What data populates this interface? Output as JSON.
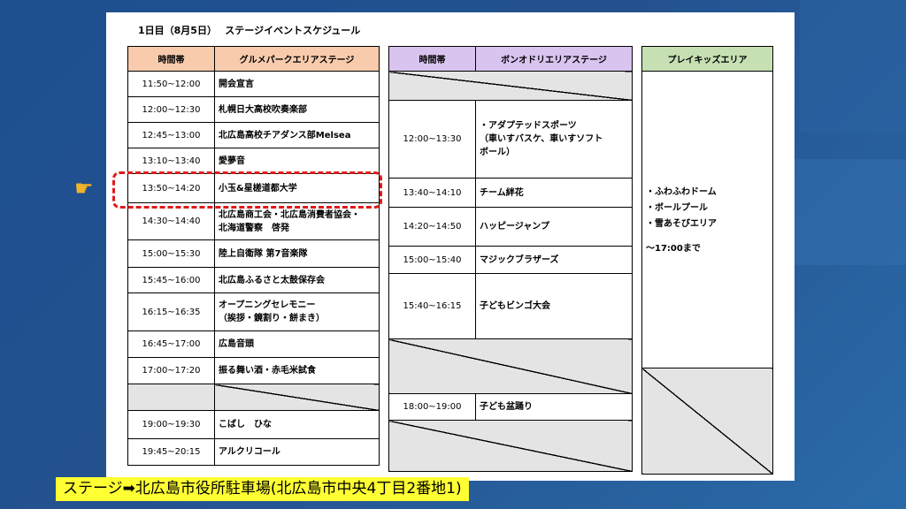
{
  "document": {
    "title": "1日目（8月5日）　 ステージイベントスケジュール"
  },
  "gourmet": {
    "col_time": "時間帯",
    "col_stage": "グルメパークエリアステージ",
    "rows": [
      {
        "time": "11:50~12:00",
        "event": "開会宣言"
      },
      {
        "time": "12:00~12:30",
        "event": "札幌日大高校吹奏楽部"
      },
      {
        "time": "12:45~13:00",
        "event": "北広島高校チアダンス部Melsea"
      },
      {
        "time": "13:10~13:40",
        "event": "愛夢音"
      },
      {
        "time": "13:50~14:20",
        "event": "小玉&星槎道都大学"
      },
      {
        "time": "14:30~14:40",
        "event": "北広島商工会・北広島消費者協会・\n北海道警察　啓発"
      },
      {
        "time": "15:00~15:30",
        "event": "陸上自衛隊 第7音楽隊"
      },
      {
        "time": "15:45~16:00",
        "event": "北広島ふるさと太鼓保存会"
      },
      {
        "time": "16:15~16:35",
        "event": "オープニングセレモニー\n（挨拶・鏡割り・餅まき）"
      },
      {
        "time": "16:45~17:00",
        "event": "広島音頭"
      },
      {
        "time": "17:00~17:20",
        "event": "振る舞い酒・赤毛米試食"
      },
      {
        "time": "19:00~19:30",
        "event": "こばし　ひな"
      },
      {
        "time": "19:45~20:15",
        "event": "アルクリコール"
      }
    ]
  },
  "bonodori": {
    "col_time": "時間帯",
    "col_stage": "ボンオドリエリアステージ",
    "rows": [
      {
        "time": "12:00~13:30",
        "event": "・アダプテッドスポーツ\n（車いすバスケ、車いすソフト\nボール）"
      },
      {
        "time": "13:40~14:10",
        "event": "チーム絆花"
      },
      {
        "time": "14:20~14:50",
        "event": "ハッピージャンプ"
      },
      {
        "time": "15:00~15:40",
        "event": "マジックブラザーズ"
      },
      {
        "time": "15:40~16:15",
        "event": "子どもビンゴ大会"
      },
      {
        "time": "18:00~19:00",
        "event": "子ども盆踊り"
      }
    ]
  },
  "playkids": {
    "header": "プレイキッズエリア",
    "items": "・ふわふわドーム\n・ボールプール\n・雪あそびエリア",
    "note": "～17:00まで"
  },
  "caption": "ステージ➡北広島市役所駐車場(北広島市中央4丁目2番地1)",
  "highlight_color": "#e01a1a",
  "caption_background": "#ffff33"
}
